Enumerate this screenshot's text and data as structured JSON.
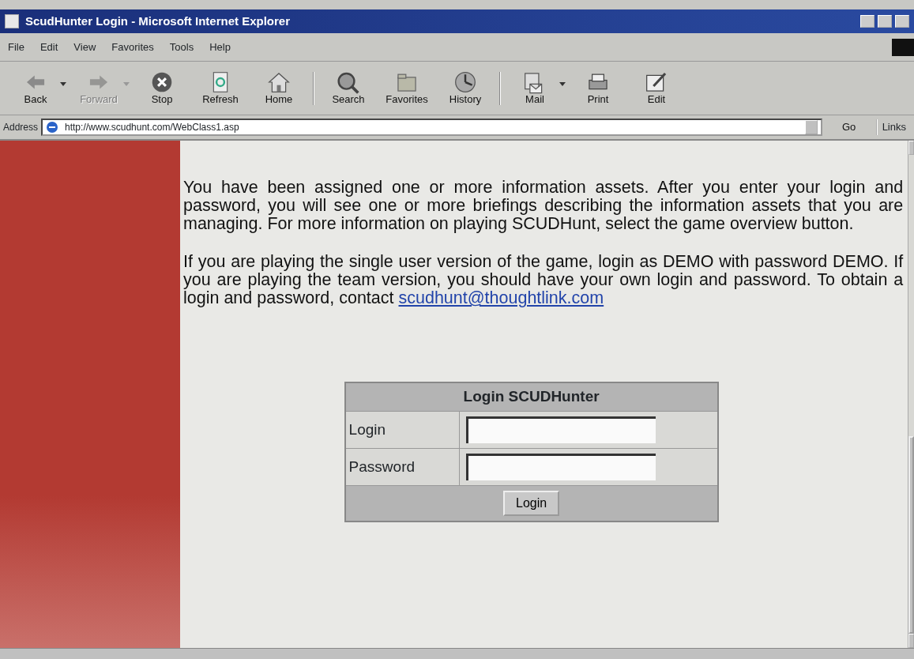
{
  "window": {
    "title": "ScudHunter Login - Microsoft Internet Explorer"
  },
  "menu": [
    "File",
    "Edit",
    "View",
    "Favorites",
    "Tools",
    "Help"
  ],
  "toolbar": [
    {
      "label": "Back",
      "disabled": false,
      "dropdown": true
    },
    {
      "label": "Forward",
      "disabled": true,
      "dropdown": true
    },
    {
      "label": "Stop",
      "disabled": false,
      "dropdown": false
    },
    {
      "label": "Refresh",
      "disabled": false,
      "dropdown": false
    },
    {
      "label": "Home",
      "disabled": false,
      "dropdown": false,
      "separator_after": true
    },
    {
      "label": "Search",
      "disabled": false,
      "dropdown": false
    },
    {
      "label": "Favorites",
      "disabled": false,
      "dropdown": false
    },
    {
      "label": "History",
      "disabled": false,
      "dropdown": false,
      "separator_after": true
    },
    {
      "label": "Mail",
      "disabled": false,
      "dropdown": true
    },
    {
      "label": "Print",
      "disabled": false,
      "dropdown": false
    },
    {
      "label": "Edit",
      "disabled": false,
      "dropdown": false
    }
  ],
  "address_bar": {
    "label": "Address",
    "value": "http://www.scudhunt.com/WebClass1.asp",
    "go": "Go",
    "links": "Links"
  },
  "content": {
    "paragraph_1": "You have been assigned one or more information assets. After you enter your login and password, you will see one or more briefings describing the information assets that you are managing. For more information on playing SCUDHunt, select the game overview button.",
    "paragraph_2": "If you are playing the single user version of the game, login as DEMO with password DEMO. If you are playing the team version, you should have your own login and password. To obtain a login and password, contact",
    "email_link": "scudhunt@thoughtlink.com"
  },
  "login_form": {
    "title": "Login SCUDHunter",
    "fields": [
      {
        "label": "Login"
      },
      {
        "label": "Password"
      }
    ],
    "button": "Login"
  }
}
